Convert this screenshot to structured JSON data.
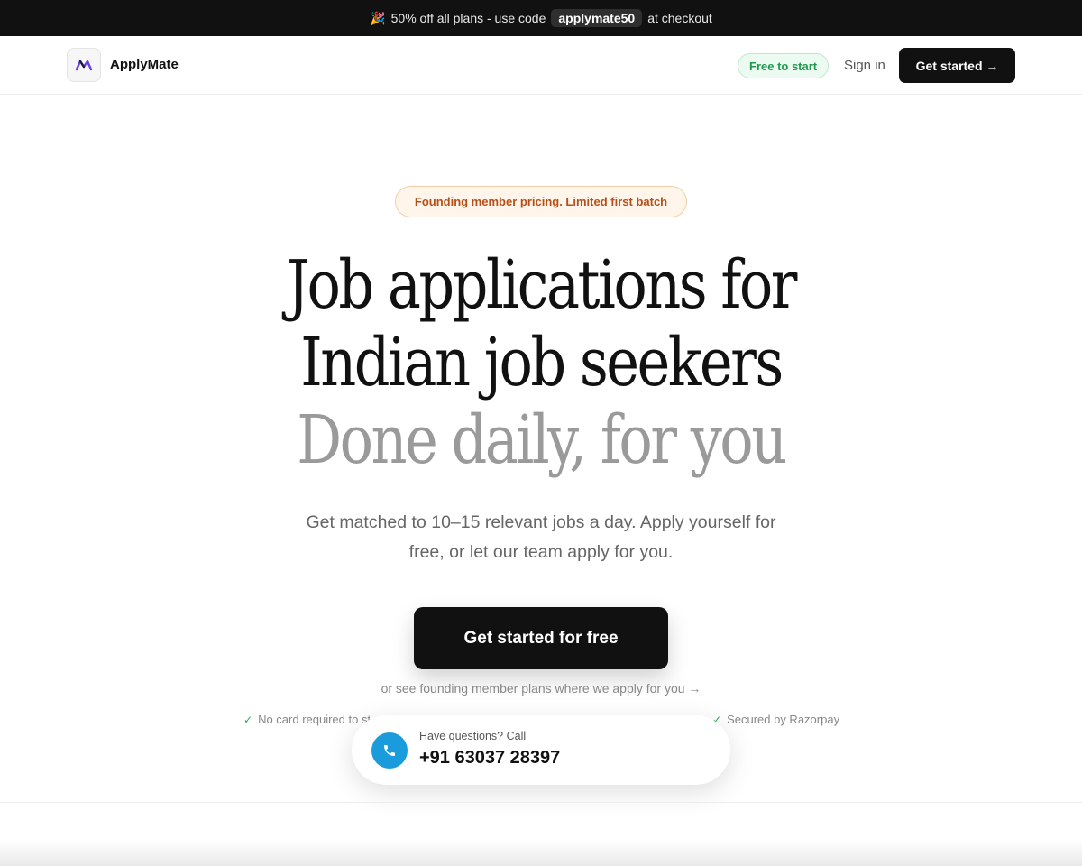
{
  "promo": {
    "emoji": "🎉",
    "text_before": "50% off all plans - use code",
    "code": "applymate50",
    "text_after": "at checkout"
  },
  "nav": {
    "brand": "ApplyMate",
    "free_pill": "Free to start",
    "sign_in": "Sign in",
    "cta": "Get started →"
  },
  "hero": {
    "badge": "Founding member pricing. Limited first batch",
    "headline_line1": "Job applications for",
    "headline_line2": "Indian job seekers",
    "headline_line3": "Done daily, for you",
    "subtext": "Get matched to 10–15 relevant jobs a day. Apply yourself for free, or let our team apply for you.",
    "cta": "Get started for free",
    "plans_link": "or see founding member plans where we apply for you →"
  },
  "trust": {
    "left": "No card required to st",
    "right": "Secured by Razorpay"
  },
  "call_card": {
    "label": "Have questions? Call",
    "number": "+91 63037 28397",
    "icon": "phone-icon"
  },
  "colors": {
    "dark": "#111111",
    "green": "#1f9a4c",
    "orange": "#b5501a",
    "blue": "#1a9bdc",
    "muted_headline": "#9a9a9a"
  }
}
